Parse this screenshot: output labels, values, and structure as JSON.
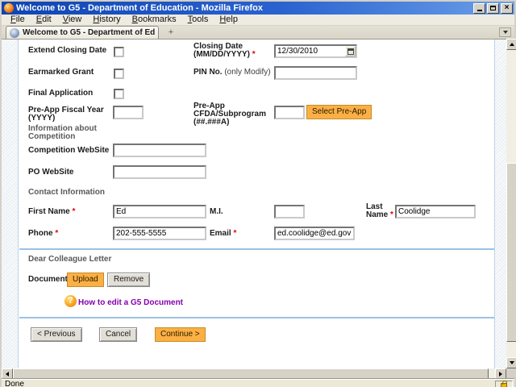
{
  "window": {
    "title": "Welcome to G5 - Department of Education - Mozilla Firefox"
  },
  "menubar": {
    "items": [
      "File",
      "Edit",
      "View",
      "History",
      "Bookmarks",
      "Tools",
      "Help"
    ]
  },
  "tabbar": {
    "active_tab_title": "Welcome to G5 - Department of Edu...",
    "new_tab_label": "+"
  },
  "form": {
    "required_marker": "*",
    "extend_closing_date_label": "Extend Closing Date",
    "closing_date_label_line1": "Closing Date",
    "closing_date_label_line2": "(MM/DD/YYYY)",
    "closing_date_value": "12/30/2010",
    "earmarked_grant_label": "Earmarked Grant",
    "pin_label": "PIN No.",
    "pin_label_note": "(only Modify)",
    "final_application_label": "Final Application",
    "preapp_fy_label_line1": "Pre-App Fiscal Year",
    "preapp_fy_label_line2": "(YYYY)",
    "preapp_cfda_label_line1": "Pre-App",
    "preapp_cfda_label_line2": "CFDA/Subprogram",
    "preapp_cfda_label_line3": "(##.###A)",
    "select_preapp_button": "Select Pre-App",
    "info_competition_heading_line1": "Information about",
    "info_competition_heading_line2": "Competition",
    "competition_website_label": "Competition WebSite",
    "po_website_label": "PO WebSite",
    "contact_heading": "Contact Information",
    "first_name_label": "First Name",
    "first_name_value": "Ed",
    "mi_label": "M.I.",
    "last_name_label_line1": "Last",
    "last_name_label_line2": "Name",
    "last_name_value": "Coolidge",
    "phone_label": "Phone",
    "phone_value": "202-555-5555",
    "email_label": "Email",
    "email_value": "ed.coolidge@ed.gov",
    "dear_colleague_heading": "Dear Colleague Letter",
    "document_label": "Document",
    "upload_button": "Upload",
    "remove_button": "Remove",
    "help_link": "How to edit a G5 Document",
    "previous_button": "< Previous",
    "cancel_button": "Cancel",
    "continue_button": "Continue >"
  },
  "statusbar": {
    "text": "Done"
  },
  "colors": {
    "accent_orange": "#fbb044",
    "link_purple": "#8500ad",
    "divider_blue": "#9dc1e4",
    "required_red": "#e00000",
    "titlebar_blue": "#2a63cf"
  }
}
